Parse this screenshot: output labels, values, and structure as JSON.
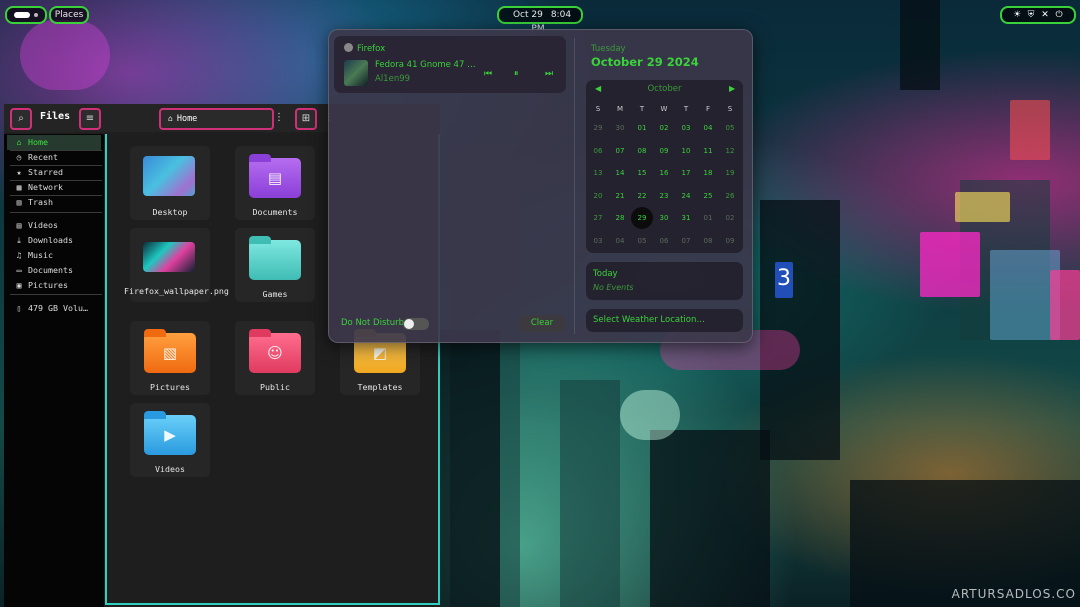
{
  "topbar": {
    "places": "Places",
    "date": "Oct 29",
    "time": "8:04 PM",
    "system_icons": [
      "☀",
      "⛨",
      "✕",
      "⏻"
    ]
  },
  "files": {
    "title": "Files",
    "path": "Home",
    "sidebar": [
      {
        "label": "Home",
        "icon": "⌂"
      },
      {
        "label": "Recent",
        "icon": "◷"
      },
      {
        "label": "Starred",
        "icon": "★"
      },
      {
        "label": "Network",
        "icon": "▦"
      },
      {
        "label": "Trash",
        "icon": "▥"
      },
      {
        "label": "Videos",
        "icon": "▤"
      },
      {
        "label": "Downloads",
        "icon": "⤓"
      },
      {
        "label": "Music",
        "icon": "♫"
      },
      {
        "label": "Documents",
        "icon": "▭"
      },
      {
        "label": "Pictures",
        "icon": "▣"
      },
      {
        "label": "479 GB Volu…",
        "icon": "▯"
      }
    ],
    "items": [
      {
        "label": "Desktop"
      },
      {
        "label": "Documents"
      },
      {
        "label": "Firefox_wallpaper.png"
      },
      {
        "label": "Games"
      },
      {
        "label": "Pictures"
      },
      {
        "label": "Public"
      },
      {
        "label": "Templates"
      },
      {
        "label": "Videos"
      }
    ]
  },
  "media": {
    "app": "Firefox",
    "title": "Fedora 41 Gnome 47 …",
    "artist": "Al1en99",
    "controls": [
      "⏮",
      "⏸",
      "⏭"
    ]
  },
  "notifications": {
    "dnd_label": "Do Not Disturb",
    "clear_label": "Clear"
  },
  "calendar": {
    "weekday": "Tuesday",
    "full_date": "October 29 2024",
    "month": "October",
    "day_headers": [
      "S",
      "M",
      "T",
      "W",
      "T",
      "F",
      "S"
    ],
    "weeks": [
      [
        "29",
        "30",
        "01",
        "02",
        "03",
        "04",
        "05"
      ],
      [
        "06",
        "07",
        "08",
        "09",
        "10",
        "11",
        "12"
      ],
      [
        "13",
        "14",
        "15",
        "16",
        "17",
        "18",
        "19"
      ],
      [
        "20",
        "21",
        "22",
        "23",
        "24",
        "25",
        "26"
      ],
      [
        "27",
        "28",
        "29",
        "30",
        "31",
        "01",
        "02"
      ],
      [
        "03",
        "04",
        "05",
        "06",
        "07",
        "08",
        "09"
      ]
    ],
    "today_label": "Today",
    "no_events": "No Events",
    "weather": "Select Weather Location…"
  },
  "desktop": {
    "watermark": "ARTURSADLOS.CO",
    "billboard_number": "3"
  },
  "colors": {
    "accent": "#3ad13a",
    "pink_border": "#d0307a",
    "teal_border": "#2fd0c0"
  }
}
